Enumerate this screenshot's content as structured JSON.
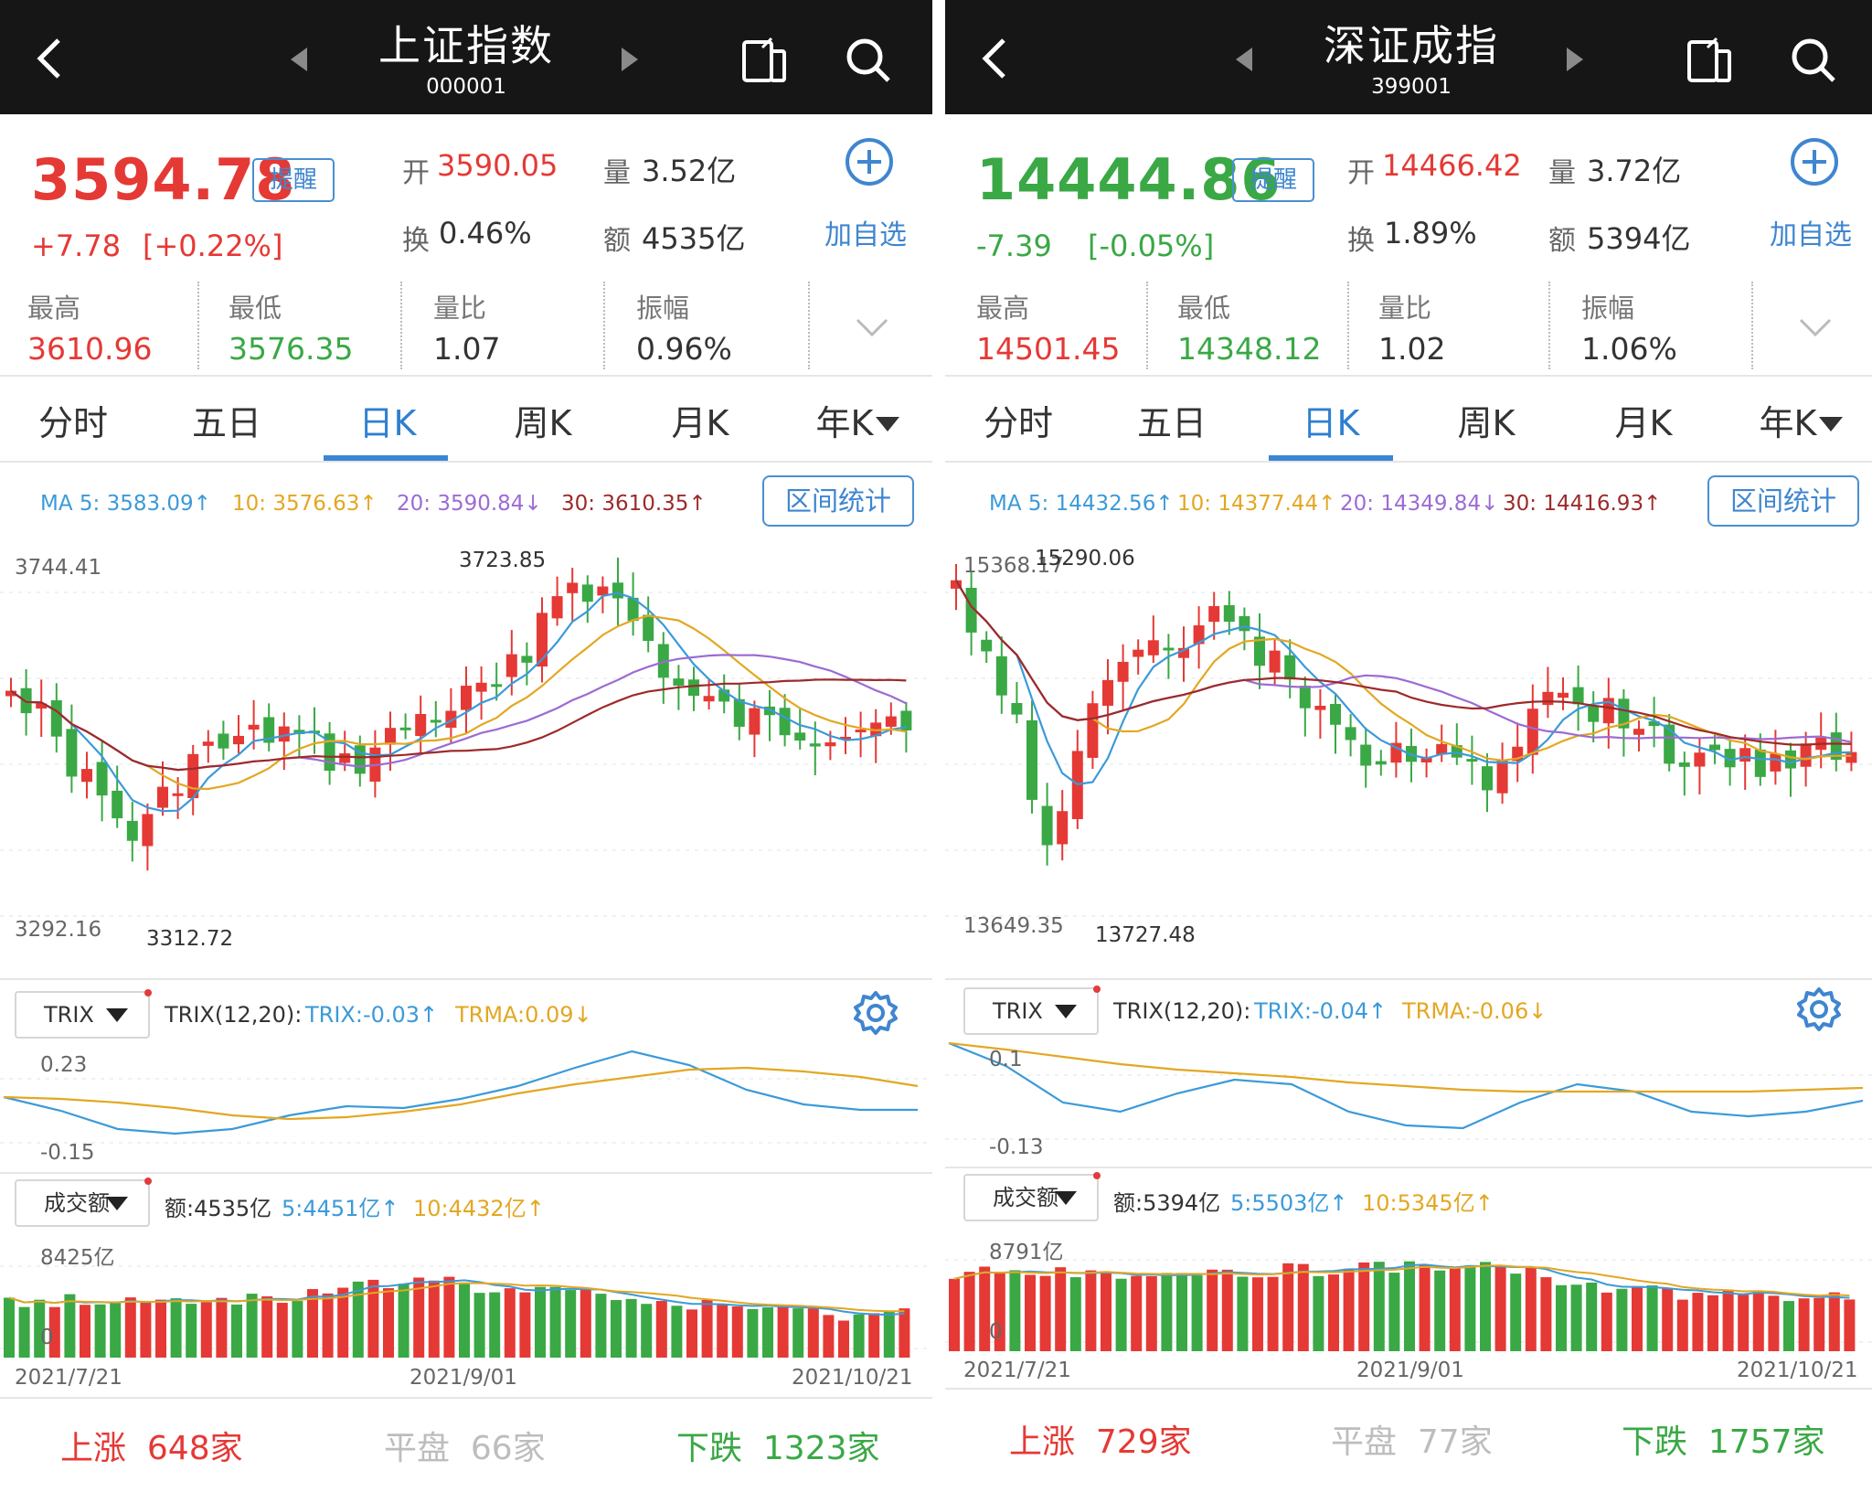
{
  "left": {
    "title": "上证指数",
    "code": "000001",
    "price": "3594.78",
    "remind": "提醒",
    "change": "+7.78",
    "change_pct": "[+0.22%]",
    "open_label": "开",
    "open": "3590.05",
    "volume_label": "量",
    "volume": "3.52亿",
    "turnover_label": "换",
    "turnover": "0.46%",
    "amount_label": "额",
    "amount": "4535亿",
    "add_label": "加自选",
    "high_label": "最高",
    "high": "3610.96",
    "low_label": "最低",
    "low": "3576.35",
    "vr_label": "量比",
    "vr": "1.07",
    "amp_label": "振幅",
    "amp": "0.96%",
    "tabs": [
      "分时",
      "五日",
      "日K",
      "周K",
      "月K",
      "年K"
    ],
    "ma5": "MA 5: 3583.09↑",
    "ma10": "10: 3576.63↑",
    "ma20": "20: 3590.84↓",
    "ma30": "30: 3610.35↑",
    "range_btn": "区间统计",
    "y_top": "3744.41",
    "y_bottom": "3292.16",
    "max_label": "3723.85",
    "min_label": "3312.72",
    "trix_btn": "TRIX",
    "trix_name": "TRIX(12,20):",
    "trix_val": "TRIX:-0.03↑",
    "trma_val": "TRMA:0.09↓",
    "trix_top": "0.23",
    "trix_bottom": "-0.15",
    "vol_btn": "成交额",
    "vol_amt": "额:4535亿",
    "vol_5": "5:4451亿↑",
    "vol_10": "10:4432亿↑",
    "vol_top": "8425亿",
    "vol_zero": "0",
    "date1": "2021/7/21",
    "date2": "2021/9/01",
    "date3": "2021/10/21",
    "up": "上涨",
    "up_n": "648家",
    "flat": "平盘",
    "flat_n": "66家",
    "down": "下跌",
    "down_n": "1323家"
  },
  "right": {
    "title": "深证成指",
    "code": "399001",
    "price": "14444.86",
    "remind": "提醒",
    "change": "-7.39",
    "change_pct": "[-0.05%]",
    "open_label": "开",
    "open": "14466.42",
    "volume_label": "量",
    "volume": "3.72亿",
    "turnover_label": "换",
    "turnover": "1.89%",
    "amount_label": "额",
    "amount": "5394亿",
    "add_label": "加自选",
    "high_label": "最高",
    "high": "14501.45",
    "low_label": "最低",
    "low": "14348.12",
    "vr_label": "量比",
    "vr": "1.02",
    "amp_label": "振幅",
    "amp": "1.06%",
    "tabs": [
      "分时",
      "五日",
      "日K",
      "周K",
      "月K",
      "年K"
    ],
    "ma5": "MA 5: 14432.56↑",
    "ma10": "10: 14377.44↑",
    "ma20": "20: 14349.84↓",
    "ma30": "30: 14416.93↑",
    "range_btn": "区间统计",
    "y_top": "15368.17",
    "y_bottom": "13649.35",
    "max_label": "15290.06",
    "min_label": "13727.48",
    "trix_btn": "TRIX",
    "trix_name": "TRIX(12,20):",
    "trix_val": "TRIX:-0.04↑",
    "trma_val": "TRMA:-0.06↓",
    "trix_top": "0.1",
    "trix_bottom": "-0.13",
    "vol_btn": "成交额",
    "vol_amt": "额:5394亿",
    "vol_5": "5:5503亿↑",
    "vol_10": "10:5345亿↑",
    "vol_top": "8791亿",
    "vol_zero": "0",
    "date1": "2021/7/21",
    "date2": "2021/9/01",
    "date3": "2021/10/21",
    "up": "上涨",
    "up_n": "729家",
    "flat": "平盘",
    "flat_n": "77家",
    "down": "下跌",
    "down_n": "1757家"
  },
  "colors": {
    "red": "#e53935",
    "green": "#3aa845",
    "blue": "#3b8fd4",
    "ma5": "#3b9ad9",
    "ma10": "#e3a722",
    "ma20": "#9c6bd3",
    "ma30": "#9d2a2a"
  }
}
